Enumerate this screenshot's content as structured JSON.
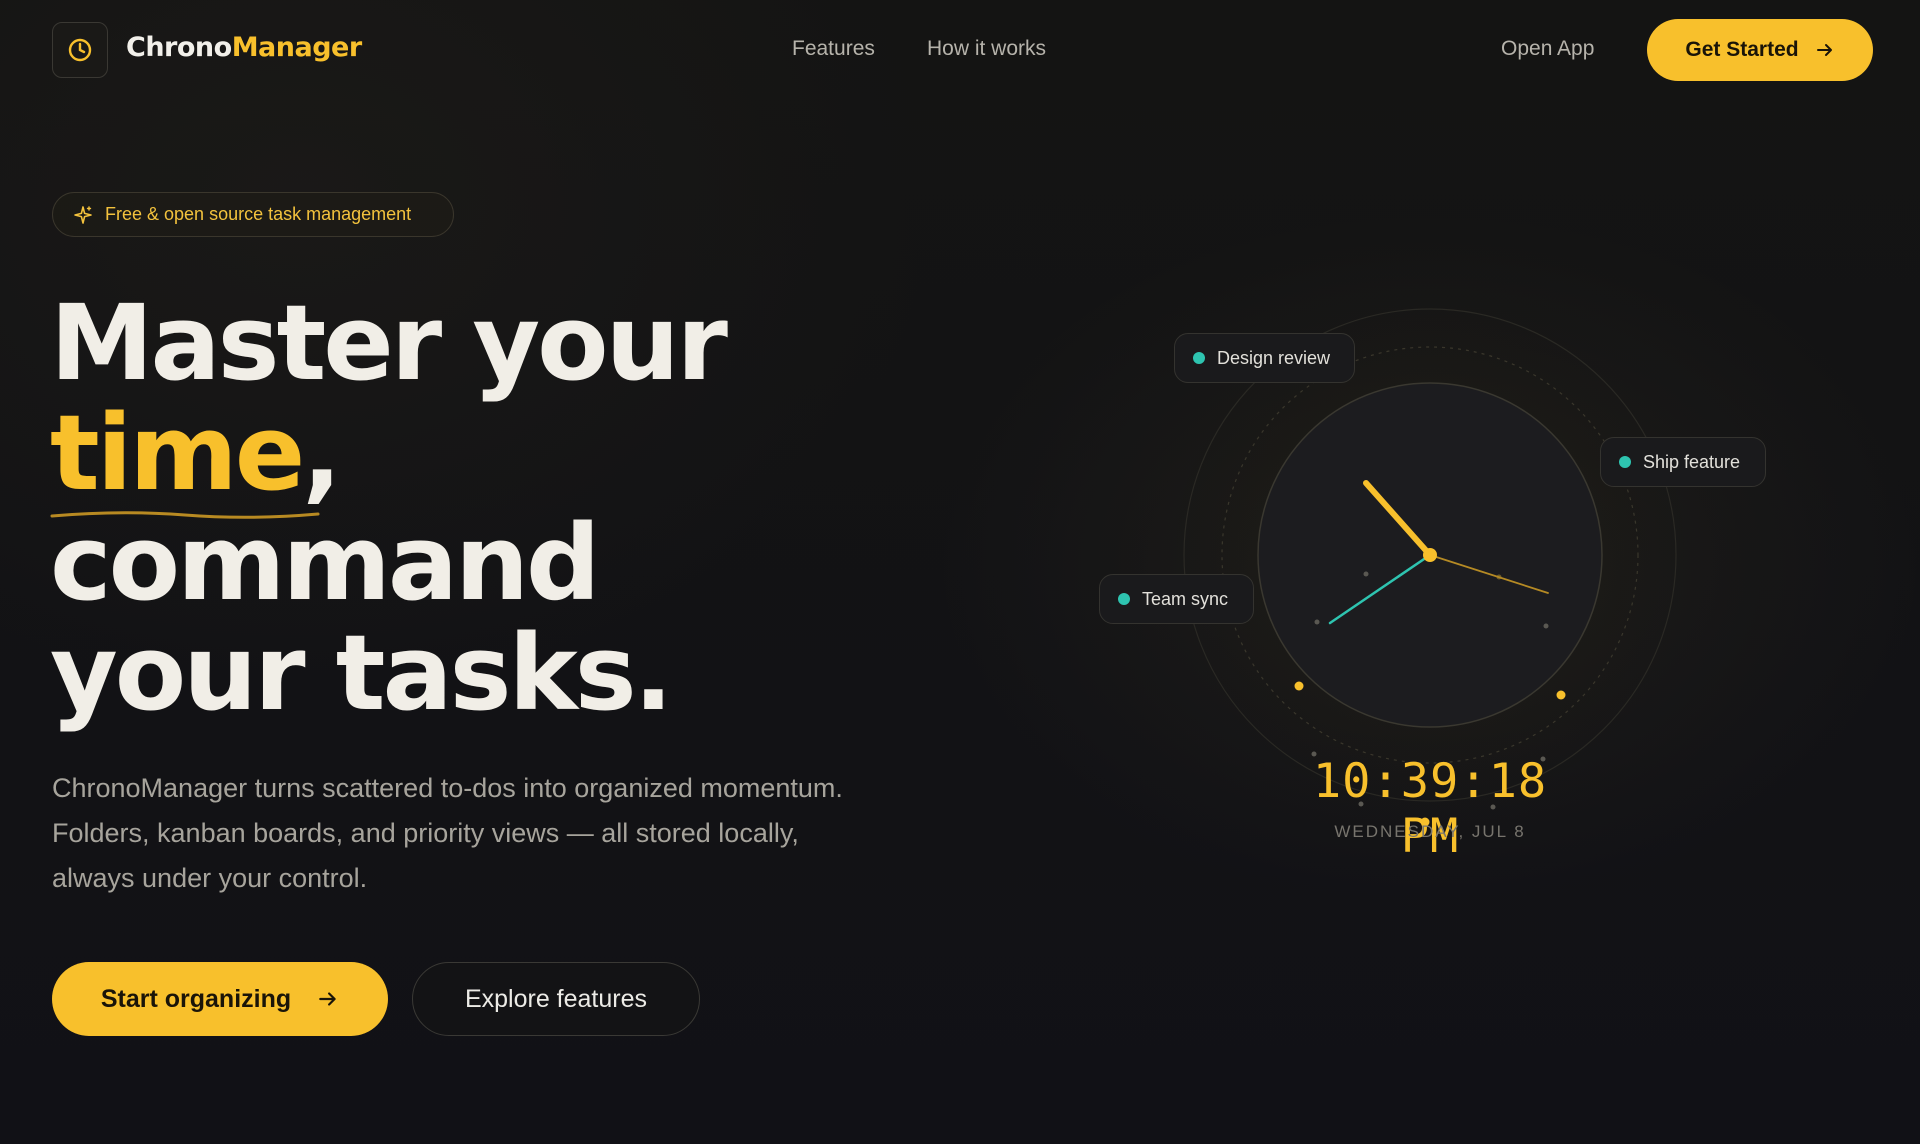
{
  "brand": {
    "name_part1": "Chrono",
    "name_part2": "Manager",
    "logo_icon": "clock-icon"
  },
  "nav": {
    "links": [
      "Features",
      "How it works"
    ],
    "open_app": "Open App",
    "cta": "Get Started"
  },
  "hero": {
    "badge": "Free & open source task management",
    "headline": {
      "line1": "Master your",
      "accent": "time",
      "accent_suffix": ",",
      "line3": "command",
      "line4": "your tasks."
    },
    "subtext": "ChronoManager turns scattered to-dos into organized momentum. Folders, kanban boards, and priority views — all stored locally, always under your control.",
    "primary_cta": "Start organizing",
    "secondary_cta": "Explore features"
  },
  "clock": {
    "chips": [
      "Design review",
      "Ship feature",
      "Team sync"
    ],
    "time": "10:39:18 PM",
    "date": "WEDNESDAY, JUL 8"
  },
  "colors": {
    "accent": "#f8c02c",
    "teal": "#2ec4b0",
    "background": "#121216"
  }
}
